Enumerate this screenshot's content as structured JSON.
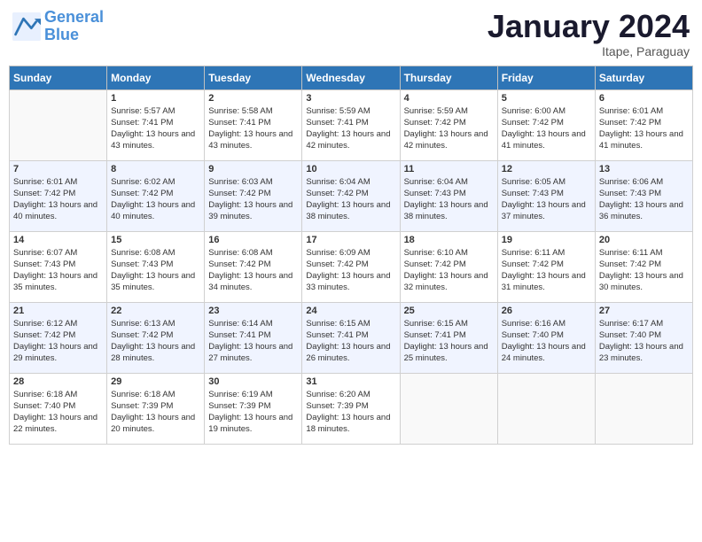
{
  "logo": {
    "line1": "General",
    "line2": "Blue"
  },
  "title": "January 2024",
  "subtitle": "Itape, Paraguay",
  "weekdays": [
    "Sunday",
    "Monday",
    "Tuesday",
    "Wednesday",
    "Thursday",
    "Friday",
    "Saturday"
  ],
  "weeks": [
    [
      {
        "day": "",
        "sunrise": "",
        "sunset": "",
        "daylight": ""
      },
      {
        "day": "1",
        "sunrise": "Sunrise: 5:57 AM",
        "sunset": "Sunset: 7:41 PM",
        "daylight": "Daylight: 13 hours and 43 minutes."
      },
      {
        "day": "2",
        "sunrise": "Sunrise: 5:58 AM",
        "sunset": "Sunset: 7:41 PM",
        "daylight": "Daylight: 13 hours and 43 minutes."
      },
      {
        "day": "3",
        "sunrise": "Sunrise: 5:59 AM",
        "sunset": "Sunset: 7:41 PM",
        "daylight": "Daylight: 13 hours and 42 minutes."
      },
      {
        "day": "4",
        "sunrise": "Sunrise: 5:59 AM",
        "sunset": "Sunset: 7:42 PM",
        "daylight": "Daylight: 13 hours and 42 minutes."
      },
      {
        "day": "5",
        "sunrise": "Sunrise: 6:00 AM",
        "sunset": "Sunset: 7:42 PM",
        "daylight": "Daylight: 13 hours and 41 minutes."
      },
      {
        "day": "6",
        "sunrise": "Sunrise: 6:01 AM",
        "sunset": "Sunset: 7:42 PM",
        "daylight": "Daylight: 13 hours and 41 minutes."
      }
    ],
    [
      {
        "day": "7",
        "sunrise": "Sunrise: 6:01 AM",
        "sunset": "Sunset: 7:42 PM",
        "daylight": "Daylight: 13 hours and 40 minutes."
      },
      {
        "day": "8",
        "sunrise": "Sunrise: 6:02 AM",
        "sunset": "Sunset: 7:42 PM",
        "daylight": "Daylight: 13 hours and 40 minutes."
      },
      {
        "day": "9",
        "sunrise": "Sunrise: 6:03 AM",
        "sunset": "Sunset: 7:42 PM",
        "daylight": "Daylight: 13 hours and 39 minutes."
      },
      {
        "day": "10",
        "sunrise": "Sunrise: 6:04 AM",
        "sunset": "Sunset: 7:42 PM",
        "daylight": "Daylight: 13 hours and 38 minutes."
      },
      {
        "day": "11",
        "sunrise": "Sunrise: 6:04 AM",
        "sunset": "Sunset: 7:43 PM",
        "daylight": "Daylight: 13 hours and 38 minutes."
      },
      {
        "day": "12",
        "sunrise": "Sunrise: 6:05 AM",
        "sunset": "Sunset: 7:43 PM",
        "daylight": "Daylight: 13 hours and 37 minutes."
      },
      {
        "day": "13",
        "sunrise": "Sunrise: 6:06 AM",
        "sunset": "Sunset: 7:43 PM",
        "daylight": "Daylight: 13 hours and 36 minutes."
      }
    ],
    [
      {
        "day": "14",
        "sunrise": "Sunrise: 6:07 AM",
        "sunset": "Sunset: 7:43 PM",
        "daylight": "Daylight: 13 hours and 35 minutes."
      },
      {
        "day": "15",
        "sunrise": "Sunrise: 6:08 AM",
        "sunset": "Sunset: 7:43 PM",
        "daylight": "Daylight: 13 hours and 35 minutes."
      },
      {
        "day": "16",
        "sunrise": "Sunrise: 6:08 AM",
        "sunset": "Sunset: 7:42 PM",
        "daylight": "Daylight: 13 hours and 34 minutes."
      },
      {
        "day": "17",
        "sunrise": "Sunrise: 6:09 AM",
        "sunset": "Sunset: 7:42 PM",
        "daylight": "Daylight: 13 hours and 33 minutes."
      },
      {
        "day": "18",
        "sunrise": "Sunrise: 6:10 AM",
        "sunset": "Sunset: 7:42 PM",
        "daylight": "Daylight: 13 hours and 32 minutes."
      },
      {
        "day": "19",
        "sunrise": "Sunrise: 6:11 AM",
        "sunset": "Sunset: 7:42 PM",
        "daylight": "Daylight: 13 hours and 31 minutes."
      },
      {
        "day": "20",
        "sunrise": "Sunrise: 6:11 AM",
        "sunset": "Sunset: 7:42 PM",
        "daylight": "Daylight: 13 hours and 30 minutes."
      }
    ],
    [
      {
        "day": "21",
        "sunrise": "Sunrise: 6:12 AM",
        "sunset": "Sunset: 7:42 PM",
        "daylight": "Daylight: 13 hours and 29 minutes."
      },
      {
        "day": "22",
        "sunrise": "Sunrise: 6:13 AM",
        "sunset": "Sunset: 7:42 PM",
        "daylight": "Daylight: 13 hours and 28 minutes."
      },
      {
        "day": "23",
        "sunrise": "Sunrise: 6:14 AM",
        "sunset": "Sunset: 7:41 PM",
        "daylight": "Daylight: 13 hours and 27 minutes."
      },
      {
        "day": "24",
        "sunrise": "Sunrise: 6:15 AM",
        "sunset": "Sunset: 7:41 PM",
        "daylight": "Daylight: 13 hours and 26 minutes."
      },
      {
        "day": "25",
        "sunrise": "Sunrise: 6:15 AM",
        "sunset": "Sunset: 7:41 PM",
        "daylight": "Daylight: 13 hours and 25 minutes."
      },
      {
        "day": "26",
        "sunrise": "Sunrise: 6:16 AM",
        "sunset": "Sunset: 7:40 PM",
        "daylight": "Daylight: 13 hours and 24 minutes."
      },
      {
        "day": "27",
        "sunrise": "Sunrise: 6:17 AM",
        "sunset": "Sunset: 7:40 PM",
        "daylight": "Daylight: 13 hours and 23 minutes."
      }
    ],
    [
      {
        "day": "28",
        "sunrise": "Sunrise: 6:18 AM",
        "sunset": "Sunset: 7:40 PM",
        "daylight": "Daylight: 13 hours and 22 minutes."
      },
      {
        "day": "29",
        "sunrise": "Sunrise: 6:18 AM",
        "sunset": "Sunset: 7:39 PM",
        "daylight": "Daylight: 13 hours and 20 minutes."
      },
      {
        "day": "30",
        "sunrise": "Sunrise: 6:19 AM",
        "sunset": "Sunset: 7:39 PM",
        "daylight": "Daylight: 13 hours and 19 minutes."
      },
      {
        "day": "31",
        "sunrise": "Sunrise: 6:20 AM",
        "sunset": "Sunset: 7:39 PM",
        "daylight": "Daylight: 13 hours and 18 minutes."
      },
      {
        "day": "",
        "sunrise": "",
        "sunset": "",
        "daylight": ""
      },
      {
        "day": "",
        "sunrise": "",
        "sunset": "",
        "daylight": ""
      },
      {
        "day": "",
        "sunrise": "",
        "sunset": "",
        "daylight": ""
      }
    ]
  ]
}
